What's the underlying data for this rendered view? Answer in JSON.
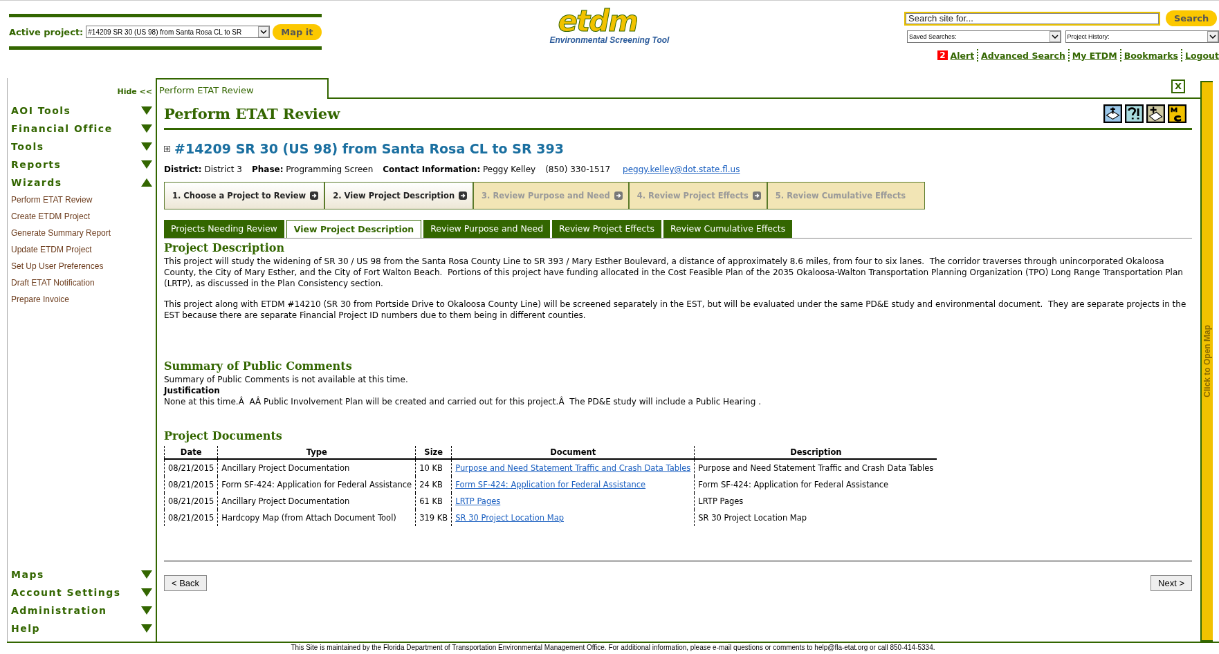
{
  "header": {
    "active_project_label": "Active project:",
    "active_project_value": "#14209 SR 30 (US 98) from Santa Rosa CL to SR",
    "map_button": "Map it",
    "logo": "etdm",
    "logo_tagline": "Environmental Screening Tool",
    "search": {
      "placeholder": "Search site for...",
      "button": "Search"
    },
    "saved_searches": "Saved Searches:",
    "project_history": "Project History:",
    "alert_count": "2",
    "links": [
      {
        "text": "Alert"
      },
      {
        "text": "Advanced Search"
      },
      {
        "text": "My ETDM"
      },
      {
        "text": "Bookmarks"
      },
      {
        "text": "Logout"
      }
    ]
  },
  "sidebar": {
    "hide": "Hide <<",
    "sections_top": [
      {
        "label": "AOI Tools",
        "expanded": false
      },
      {
        "label": "Financial Office",
        "expanded": false
      },
      {
        "label": "Tools",
        "expanded": false
      },
      {
        "label": "Reports",
        "expanded": false
      },
      {
        "label": "Wizards",
        "expanded": true,
        "items": [
          "Perform ETAT Review",
          "Create ETDM Project",
          "Generate Summary Report",
          "Update ETDM Project",
          "Set Up User Preferences",
          "Draft ETAT Notification",
          "Prepare Invoice"
        ]
      }
    ],
    "sections_bottom": [
      {
        "label": "Maps",
        "expanded": false
      },
      {
        "label": "Account Settings",
        "expanded": false
      },
      {
        "label": "Administration",
        "expanded": false
      },
      {
        "label": "Help",
        "expanded": false
      }
    ]
  },
  "main": {
    "tab": "Perform ETAT Review",
    "close": "X",
    "title": "Perform ETAT Review",
    "project_title": "#14209 SR 30 (US 98) from Santa Rosa CL to SR 393",
    "info": [
      {
        "label": "District:",
        "value": "District 3"
      },
      {
        "label": "Phase:",
        "value": "Programming Screen"
      },
      {
        "label": "Contact Information:",
        "value": "Peggy Kelley"
      }
    ],
    "phone": "(850) 330-1517",
    "email": "peggy.kelley@dot.state.fl.us",
    "steps": [
      {
        "label": "1. Choose a Project to Review",
        "disabled": false,
        "arrow": true
      },
      {
        "label": "2. View Project Description",
        "disabled": false,
        "arrow": true
      },
      {
        "label": "3. Review Purpose and Need",
        "disabled": true,
        "arrow": true
      },
      {
        "label": "4. Review Project Effects",
        "disabled": true,
        "arrow": true
      },
      {
        "label": "5. Review Cumulative Effects",
        "disabled": true,
        "arrow": false
      }
    ],
    "tabs": [
      {
        "label": "Projects Needing Review",
        "selected": false
      },
      {
        "label": "View Project Description",
        "selected": true
      },
      {
        "label": "Review Purpose and Need",
        "selected": false
      },
      {
        "label": "Review Project Effects",
        "selected": false
      },
      {
        "label": "Review Cumulative Effects",
        "selected": false
      }
    ],
    "description": {
      "heading": "Project Description",
      "paragraphs": [
        "This project will study the widening of SR 30 / US 98 from the Santa Rosa County Line to SR 393 / Mary Esther Boulevard, a distance of approximately 8.6 miles, from four to six lanes.  The corridor traverses through unincorporated Okaloosa County, the City of Mary Esther, and the City of Fort Walton Beach.  Portions of this project have funding allocated in the Cost Feasible Plan of the 2035 Okaloosa-Walton Transportation Planning Organization (TPO) Long Range Transportation Plan (LRTP), as discussed in the Plan Consistency section.",
        "This project along with ETDM #14210 (SR 30 from Portside Drive to Okaloosa County Line) will be screened separately in the EST, but will be evaluated under the same PD&E study and environmental document.  They are separate projects in the EST because there are separate Financial Project ID numbers due to them being in different counties."
      ]
    },
    "comments": {
      "heading": "Summary of Public Comments",
      "text": "Summary of Public Comments is not available at this time.",
      "justification_label": "Justification",
      "justification": "None at this time.Â  AÂ Public Involvement Plan will be created and carried out for this project.Â  The PD&E study will include a Public Hearing ."
    },
    "documents": {
      "heading": "Project Documents",
      "columns": [
        "Date",
        "Type",
        "Size",
        "Document",
        "Description"
      ],
      "rows": [
        [
          "08/21/2015",
          "Ancillary Project Documentation",
          "10 KB",
          "Purpose and Need Statement Traffic and Crash Data Tables",
          "Purpose and Need Statement Traffic and Crash Data Tables"
        ],
        [
          "08/21/2015",
          "Form SF-424: Application for Federal Assistance",
          "24 KB",
          "Form SF-424: Application for Federal Assistance",
          "Form SF-424: Application for Federal Assistance"
        ],
        [
          "08/21/2015",
          "Ancillary Project Documentation",
          "61 KB",
          "LRTP Pages",
          "LRTP Pages"
        ],
        [
          "08/21/2015",
          "Hardcopy Map (from Attach Document Tool)",
          "319 KB",
          "SR 30 Project Location Map",
          "SR 30 Project Location Map"
        ]
      ]
    },
    "back": "< Back",
    "next": "Next >"
  },
  "map_strip": "Click to Open Map",
  "footer": "This Site is maintained by the Florida Department of Transportation Environmental Management Office. For additional information, please e-mail questions or comments to help@fla-etat.org or call 850-414-5334."
}
